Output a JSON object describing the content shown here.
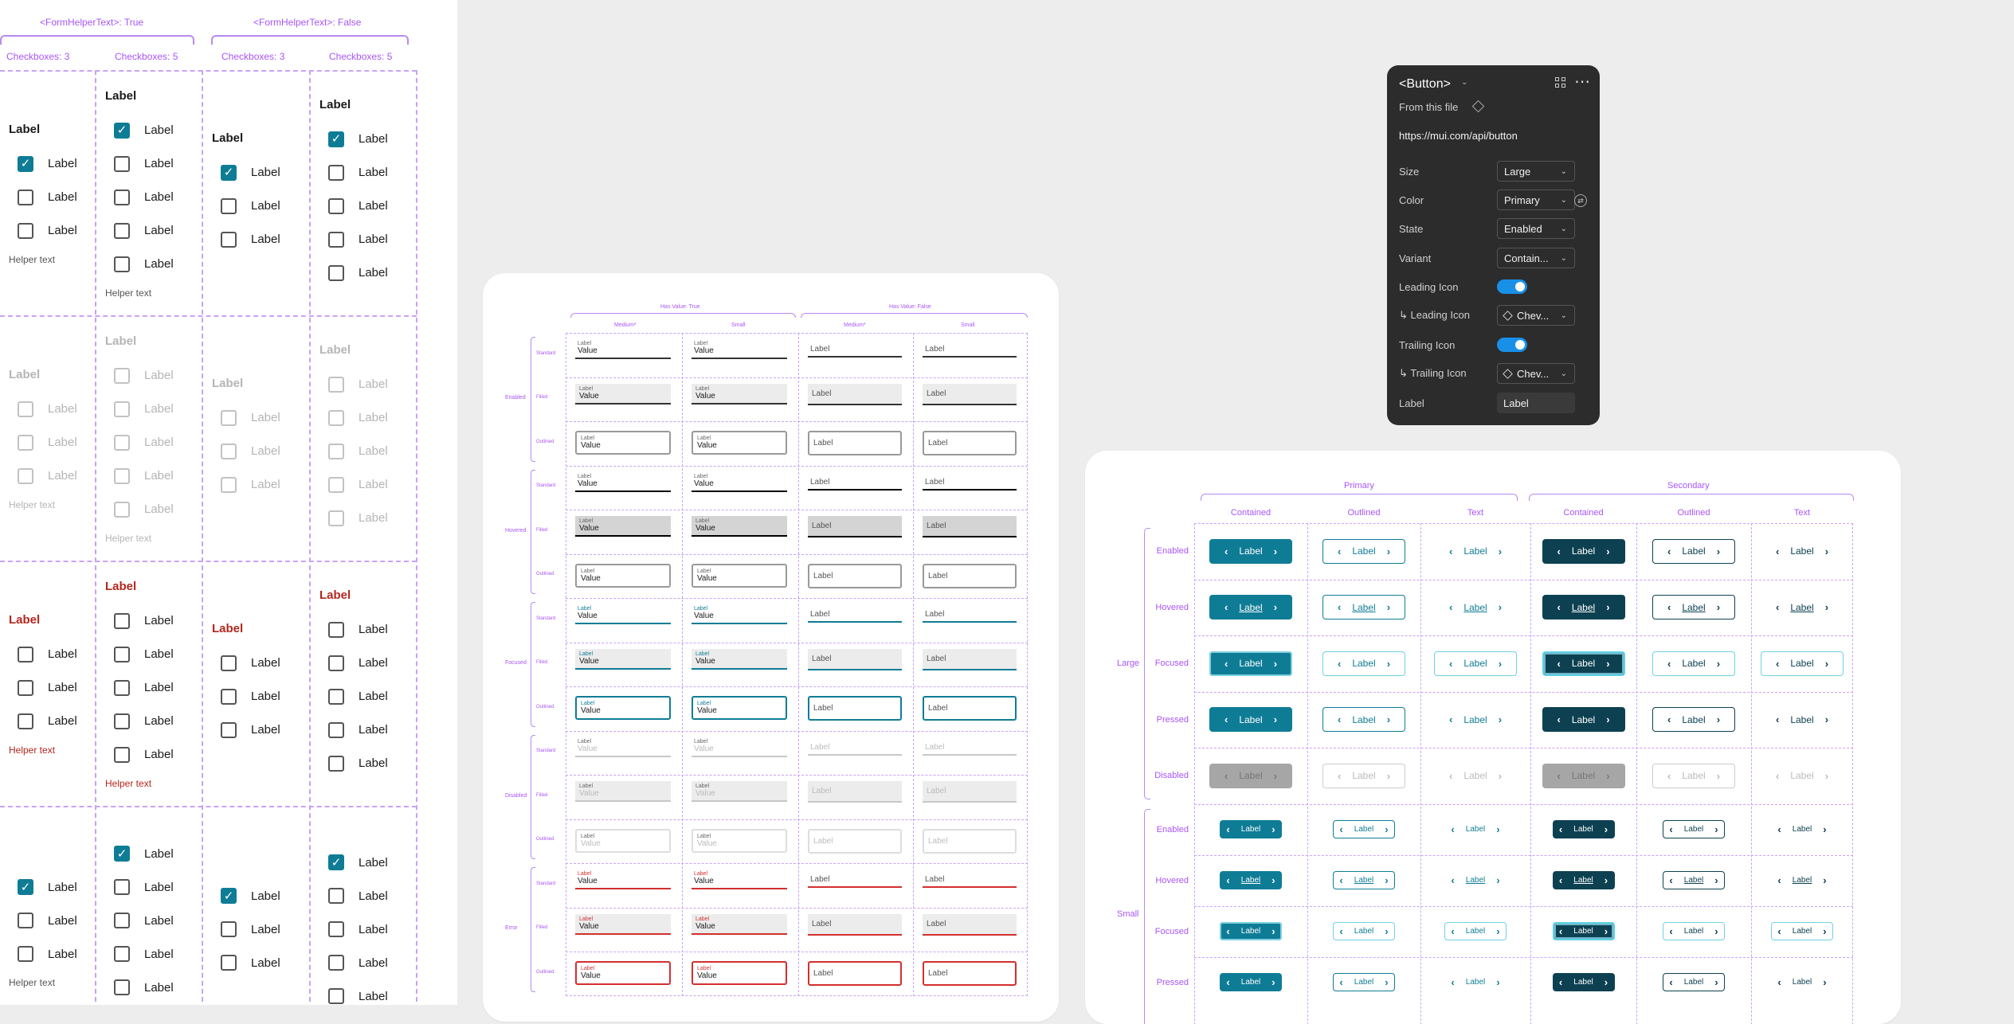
{
  "checkbox_panel": {
    "headers": {
      "helper_true": "<FormHelperText>: True",
      "helper_false": "<FormHelperText>: False",
      "cb3": "Checkboxes: 3",
      "cb5": "Checkboxes: 5"
    },
    "group_label": "Label",
    "item_label": "Label",
    "helper_text": "Helper text"
  },
  "textfield_card": {
    "headers": {
      "has_true": "Has Value: True",
      "has_false": "Has Value: False",
      "medium": "Medium*",
      "small": "Small"
    },
    "states": [
      "Enabled",
      "Hovered",
      "Focused",
      "Disabled",
      "Error"
    ],
    "variants": [
      "Standard",
      "Filled",
      "Outlined"
    ],
    "field_label": "Label",
    "field_value": "Value"
  },
  "button_card": {
    "headers": {
      "primary": "Primary",
      "secondary": "Secondary",
      "contained": "Contained",
      "outlined": "Outlined",
      "text": "Text"
    },
    "sizes": {
      "large": "Large",
      "small": "Small"
    },
    "states_large": [
      "Enabled",
      "Hovered",
      "Focused",
      "Pressed",
      "Disabled"
    ],
    "states_small": [
      "Enabled",
      "Hovered",
      "Focused",
      "Pressed"
    ],
    "button_label": "Label",
    "colors": {
      "teal": "#0f7c96",
      "navy": "#0d4152",
      "disabled": "#a6a6a6"
    }
  },
  "config_panel": {
    "title": "<Button>",
    "from_file": "From this file",
    "url": "https://mui.com/api/button",
    "rows": [
      {
        "label": "Size",
        "value": "Large"
      },
      {
        "label": "Color",
        "value": "Primary"
      },
      {
        "label": "State",
        "value": "Enabled"
      },
      {
        "label": "Variant",
        "value": "Contain..."
      },
      {
        "label": "Leading Icon",
        "toggle": true
      },
      {
        "label": "↳ Leading Icon",
        "value": "Chev..."
      },
      {
        "label": "Trailing Icon",
        "toggle": true
      },
      {
        "label": "↳ Trailing Icon",
        "value": "Chev..."
      },
      {
        "label": "Label",
        "value": "Label"
      }
    ]
  }
}
